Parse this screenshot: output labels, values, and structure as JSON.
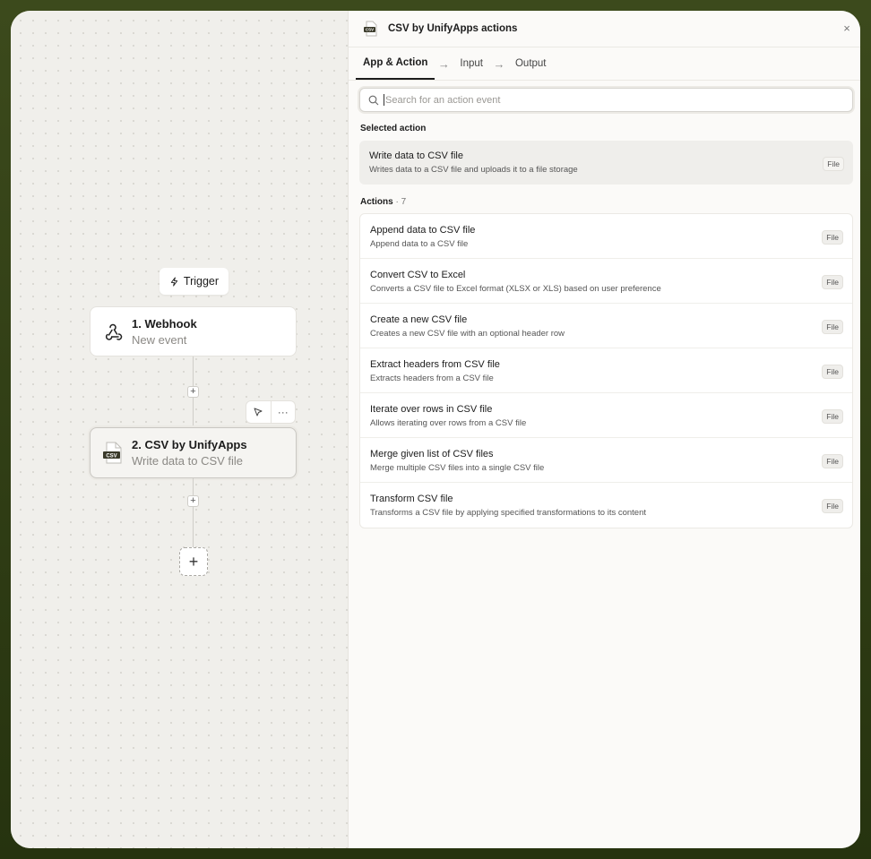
{
  "canvas": {
    "trigger_label": "Trigger",
    "nodes": [
      {
        "title": "1. Webhook",
        "subtitle": "New event",
        "icon": "webhook-icon"
      },
      {
        "title": "2. CSV by UnifyApps",
        "subtitle": "Write data to CSV file",
        "icon": "csv-file-icon",
        "icon_text": "CSV"
      }
    ],
    "plus": "+",
    "more": "···"
  },
  "panel": {
    "title": "CSV by UnifyApps actions",
    "close": "×",
    "tabs": [
      {
        "label": "App & Action",
        "active": true
      },
      {
        "label": "Input",
        "active": false
      },
      {
        "label": "Output",
        "active": false
      }
    ],
    "search": {
      "placeholder": "Search for an action event"
    },
    "selected_label": "Selected action",
    "selected": {
      "title": "Write data to CSV file",
      "desc": "Writes data to a CSV file and uploads it to a file storage",
      "badge": "File"
    },
    "actions_label": "Actions",
    "actions_count": "7",
    "actions": [
      {
        "title": "Append data to CSV file",
        "desc": "Append data to a CSV file",
        "badge": "File"
      },
      {
        "title": "Convert CSV to Excel",
        "desc": "Converts a CSV file to Excel format (XLSX or XLS) based on user preference",
        "badge": "File"
      },
      {
        "title": "Create a new CSV file",
        "desc": "Creates a new CSV file with an optional header row",
        "badge": "File"
      },
      {
        "title": "Extract headers from CSV file",
        "desc": "Extracts headers from a CSV file",
        "badge": "File"
      },
      {
        "title": "Iterate over rows in CSV file",
        "desc": "Allows iterating over rows from a CSV file",
        "badge": "File"
      },
      {
        "title": "Merge given list of CSV files",
        "desc": "Merge multiple CSV files into a single CSV file",
        "badge": "File"
      },
      {
        "title": "Transform CSV file",
        "desc": "Transforms a CSV file by applying specified transformations to its content",
        "badge": "File"
      }
    ]
  }
}
